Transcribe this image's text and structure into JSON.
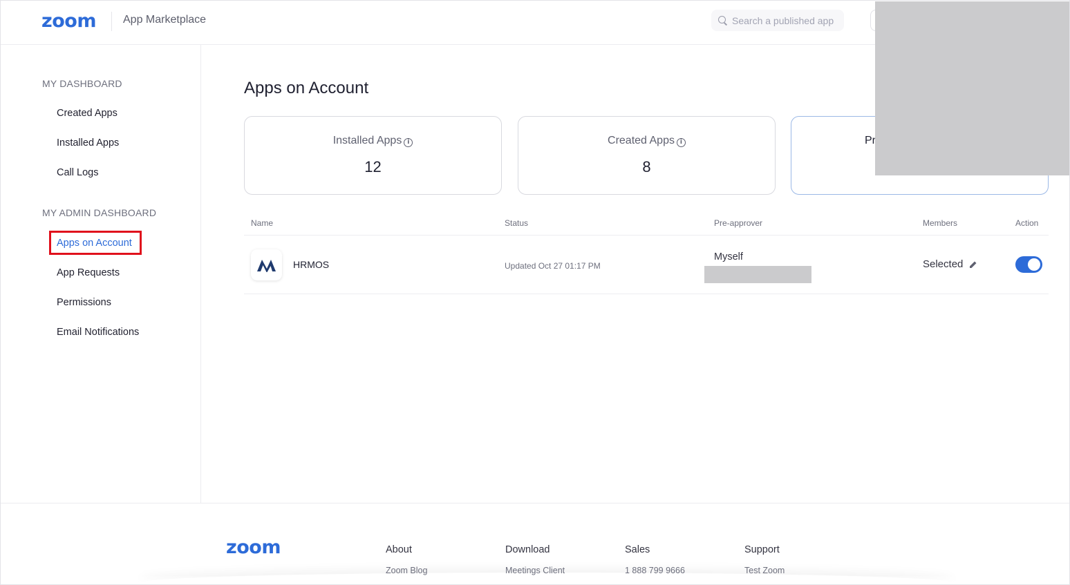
{
  "header": {
    "logo": "zoom",
    "title": "App Marketplace",
    "search_placeholder": "Search a published app"
  },
  "sidebar": {
    "section_dashboard": "MY DASHBOARD",
    "dashboard_items": [
      "Created Apps",
      "Installed Apps",
      "Call Logs"
    ],
    "section_admin": "MY ADMIN DASHBOARD",
    "admin_items": [
      "Apps on Account",
      "App Requests",
      "Permissions",
      "Email Notifications"
    ],
    "active_item": "Apps on Account"
  },
  "main": {
    "title": "Apps on Account",
    "cards": [
      {
        "label": "Installed Apps",
        "value": "12"
      },
      {
        "label": "Created Apps",
        "value": "8"
      },
      {
        "label": "Pr"
      }
    ],
    "table": {
      "columns": [
        "Name",
        "Status",
        "Pre-approver",
        "Members",
        "Action"
      ],
      "rows": [
        {
          "name": "HRMOS",
          "status": "Updated Oct 27 01:17 PM",
          "pre_approver": "Myself",
          "members": "Selected",
          "enabled": true
        }
      ]
    }
  },
  "footer": {
    "logo": "zoom",
    "columns": [
      {
        "title": "About",
        "link": "Zoom Blog"
      },
      {
        "title": "Download",
        "link": "Meetings Client"
      },
      {
        "title": "Sales",
        "link": "1 888 799 9666"
      },
      {
        "title": "Support",
        "link": "Test Zoom"
      }
    ]
  },
  "colors": {
    "brand_blue": "#2d6bd8",
    "highlight_red": "#e0101c",
    "redaction_gray": "#cbcbcd"
  }
}
